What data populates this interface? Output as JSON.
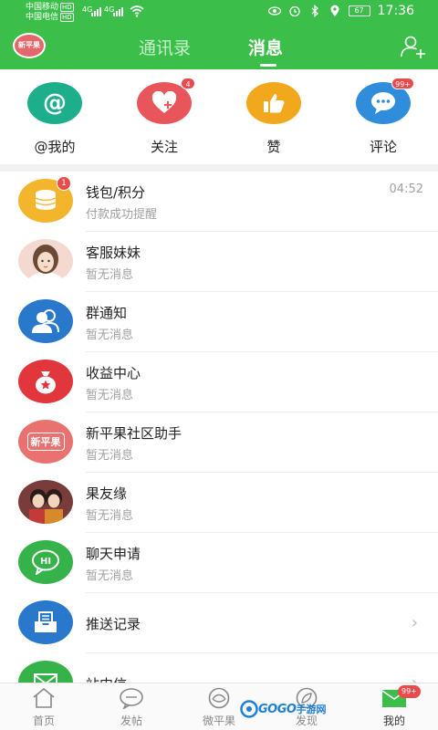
{
  "status_bar": {
    "carrier1": "中国移动",
    "carrier2": "中国电信",
    "hd": "HD",
    "net1": "4G",
    "net2": "4G",
    "battery": "67",
    "time": "17:36"
  },
  "header": {
    "logo_text": "新平果",
    "tabs": [
      {
        "label": "通讯录",
        "active": false
      },
      {
        "label": "消息",
        "active": true
      }
    ]
  },
  "quick_actions": [
    {
      "label": "@我的",
      "icon": "at-icon",
      "color": "#1dae8b",
      "badge": ""
    },
    {
      "label": "关注",
      "icon": "heart-plus-icon",
      "color": "#e8565b",
      "badge": "4"
    },
    {
      "label": "赞",
      "icon": "thumbs-up-icon",
      "color": "#f2a81d",
      "badge": ""
    },
    {
      "label": "评论",
      "icon": "chat-bubble-icon",
      "color": "#2f8ddb",
      "badge": "99+"
    }
  ],
  "messages": [
    {
      "title": "钱包/积分",
      "sub": "付款成功提醒",
      "time": "04:52",
      "badge": "1",
      "icon": "wallet-coins-icon",
      "color": "#f3b52c"
    },
    {
      "title": "客服妹妹",
      "sub": "暂无消息",
      "time": "",
      "badge": "",
      "icon": "girl-avatar-icon",
      "color": "#f3d9cf"
    },
    {
      "title": "群通知",
      "sub": "暂无消息",
      "time": "",
      "badge": "",
      "icon": "group-icon",
      "color": "#2a78cc"
    },
    {
      "title": "收益中心",
      "sub": "暂无消息",
      "time": "",
      "badge": "",
      "icon": "money-bag-icon",
      "color": "#e0363c"
    },
    {
      "title": "新平果社区助手",
      "sub": "暂无消息",
      "time": "",
      "badge": "",
      "icon": "brand-logo-icon",
      "color": "#e87270",
      "logo_text": "新平果"
    },
    {
      "title": "果友缘",
      "sub": "暂无消息",
      "time": "",
      "badge": "",
      "icon": "couple-avatar-icon",
      "color": "#7a3b3b"
    },
    {
      "title": "聊天申请",
      "sub": "暂无消息",
      "time": "",
      "badge": "",
      "icon": "hi-bubble-icon",
      "color": "#35b24a",
      "icon_text": "HI"
    }
  ],
  "single_rows": [
    {
      "title": "推送记录",
      "icon": "inbox-icon",
      "color": "#2a78cc"
    },
    {
      "title": "站内信",
      "icon": "mail-icon",
      "color": "#35b24a"
    }
  ],
  "bottom_nav": [
    {
      "label": "首页",
      "icon": "home-icon",
      "active": false
    },
    {
      "label": "发帖",
      "icon": "post-bubble-icon",
      "active": false
    },
    {
      "label": "微平果",
      "icon": "compass-icon",
      "active": false
    },
    {
      "label": "发现",
      "icon": "leaf-icon",
      "active": false
    },
    {
      "label": "我的",
      "icon": "envelope-icon",
      "active": true,
      "badge": "99+"
    }
  ],
  "watermark": {
    "text": "GOGO",
    "cn": "手游网"
  }
}
